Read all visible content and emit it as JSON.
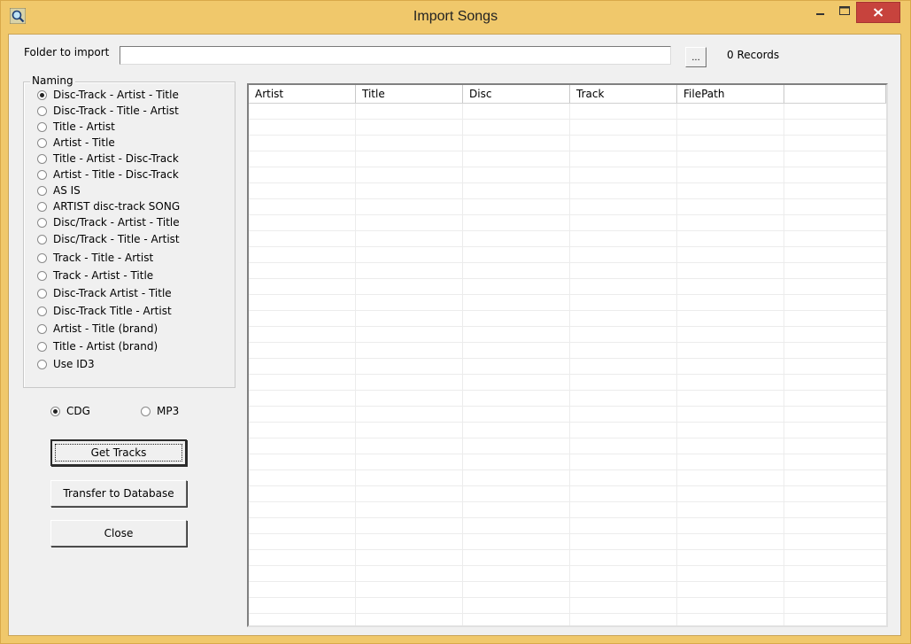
{
  "window": {
    "title": "Import Songs",
    "accent": "#f0c86b",
    "close_color": "#c7433d"
  },
  "folder": {
    "label": "Folder to import",
    "value": "",
    "browse_label": "...",
    "records": "0 Records"
  },
  "naming": {
    "legend": "Naming",
    "options": [
      {
        "label": "Disc-Track - Artist - Title",
        "selected": true
      },
      {
        "label": "Disc-Track - Title - Artist",
        "selected": false
      },
      {
        "label": "Title - Artist",
        "selected": false
      },
      {
        "label": "Artist - Title",
        "selected": false
      },
      {
        "label": "Title - Artist - Disc-Track",
        "selected": false
      },
      {
        "label": "Artist - Title - Disc-Track",
        "selected": false
      },
      {
        "label": "AS IS",
        "selected": false
      },
      {
        "label": "ARTIST  disc-track  SONG",
        "selected": false
      },
      {
        "label": "Disc/Track - Artist - Title",
        "selected": false
      },
      {
        "label": "Disc/Track - Title - Artist",
        "selected": false
      },
      {
        "label": "Track - Title - Artist",
        "selected": false
      },
      {
        "label": "Track - Artist - Title",
        "selected": false
      },
      {
        "label": "Disc-Track Artist - Title",
        "selected": false
      },
      {
        "label": "Disc-Track Title - Artist",
        "selected": false
      },
      {
        "label": "Artist - Title (brand)",
        "selected": false
      },
      {
        "label": "Title - Artist (brand)",
        "selected": false
      },
      {
        "label": "Use ID3",
        "selected": false
      }
    ]
  },
  "format": {
    "cdg_label": "CDG",
    "mp3_label": "MP3",
    "selected": "CDG"
  },
  "buttons": {
    "get_tracks": "Get Tracks",
    "transfer": "Transfer to Database",
    "close": "Close"
  },
  "table": {
    "columns": [
      "Artist",
      "Title",
      "Disc",
      "Track",
      "FilePath",
      ""
    ],
    "rows": []
  }
}
